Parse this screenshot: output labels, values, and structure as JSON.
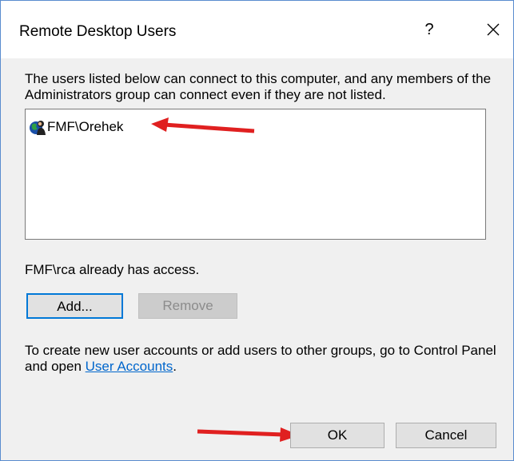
{
  "dialog": {
    "title": "Remote Desktop Users",
    "help_label": "?"
  },
  "description": "The users listed below can connect to this computer, and any members of the Administrators group can connect even if they are not listed.",
  "user_list": {
    "items": [
      {
        "label": "FMF\\Orehek",
        "icon": "user-account-icon"
      }
    ]
  },
  "access_text": "FMF\\rca already has access.",
  "buttons": {
    "add": "Add...",
    "remove": "Remove",
    "ok": "OK",
    "cancel": "Cancel"
  },
  "info": {
    "prefix": "To create new user accounts or add users to other groups, go to Control Panel and open ",
    "link": "User Accounts",
    "suffix": "."
  },
  "colors": {
    "annotation_arrow": "#e02020",
    "link": "#0066cc",
    "focus_border": "#0078d7"
  }
}
